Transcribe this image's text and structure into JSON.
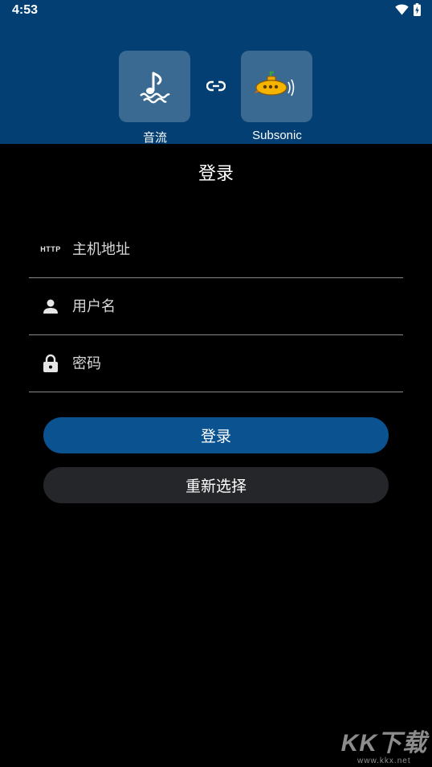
{
  "status_bar": {
    "time": "4:53",
    "icons": [
      "wifi-icon",
      "battery-charging-icon"
    ]
  },
  "header": {
    "apps": [
      {
        "label": "音流",
        "icon": "music-note-water-icon"
      },
      {
        "label": "Subsonic",
        "icon": "subsonic-submarine-icon"
      }
    ],
    "link_icon": "link-icon",
    "background_color": "#033f73"
  },
  "login": {
    "title": "登录",
    "fields": {
      "host": {
        "badge": "HTTP",
        "placeholder": "主机地址",
        "value": ""
      },
      "username": {
        "icon": "person-icon",
        "placeholder": "用户名",
        "value": ""
      },
      "password": {
        "icon": "lock-icon",
        "placeholder": "密码",
        "value": ""
      }
    },
    "buttons": {
      "login_label": "登录",
      "reselect_label": "重新选择"
    },
    "accent_color": "#0a5390"
  },
  "watermark": {
    "brand": "KK下载",
    "url": "www.kkx.net"
  }
}
